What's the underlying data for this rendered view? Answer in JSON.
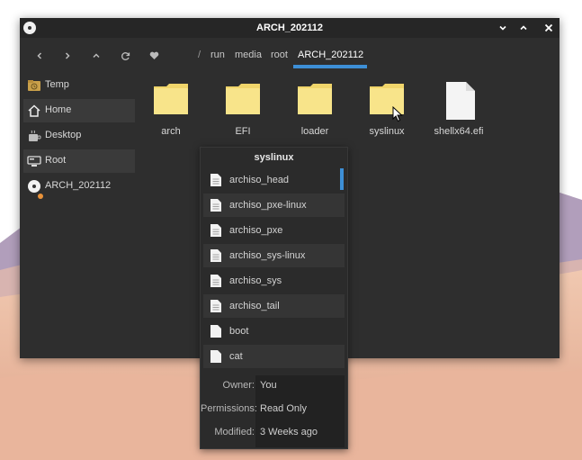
{
  "window": {
    "title": "ARCH_202112",
    "minimize_glyph": "⌄",
    "maximize_glyph": "⌃",
    "close_glyph": "✕"
  },
  "toolbar": {
    "buttons": [
      "back-icon",
      "forward-icon",
      "up-icon",
      "refresh-icon",
      "favorite-icon"
    ],
    "breadcrumb": [
      "/",
      "run",
      "media",
      "root",
      "ARCH_202112"
    ]
  },
  "sidebar": {
    "items": [
      {
        "label": "Temp",
        "icon": "temp-folder-icon"
      },
      {
        "label": "Home",
        "icon": "home-icon"
      },
      {
        "label": "Desktop",
        "icon": "desktop-icon"
      },
      {
        "label": "Root",
        "icon": "root-drive-icon"
      },
      {
        "label": "ARCH_202112",
        "icon": "disc-icon"
      }
    ]
  },
  "files": [
    {
      "name": "arch",
      "type": "folder"
    },
    {
      "name": "EFI",
      "type": "folder"
    },
    {
      "name": "loader",
      "type": "folder"
    },
    {
      "name": "syslinux",
      "type": "folder"
    },
    {
      "name": "shellx64.efi",
      "type": "file"
    }
  ],
  "popover": {
    "title": "syslinux",
    "items": [
      "archiso_head",
      "archiso_pxe-linux",
      "archiso_pxe",
      "archiso_sys-linux",
      "archiso_sys",
      "archiso_tail",
      "boot",
      "cat"
    ],
    "properties": [
      {
        "label": "Owner:",
        "value": "You"
      },
      {
        "label": "Permissions:",
        "value": "Read Only"
      },
      {
        "label": "Modified:",
        "value": "3 Weeks ago"
      }
    ]
  },
  "colors": {
    "accent": "#3d8fd6",
    "folder": "#f5e07a",
    "window_bg": "#2e2e2e",
    "eject_dot": "#e9923a"
  }
}
